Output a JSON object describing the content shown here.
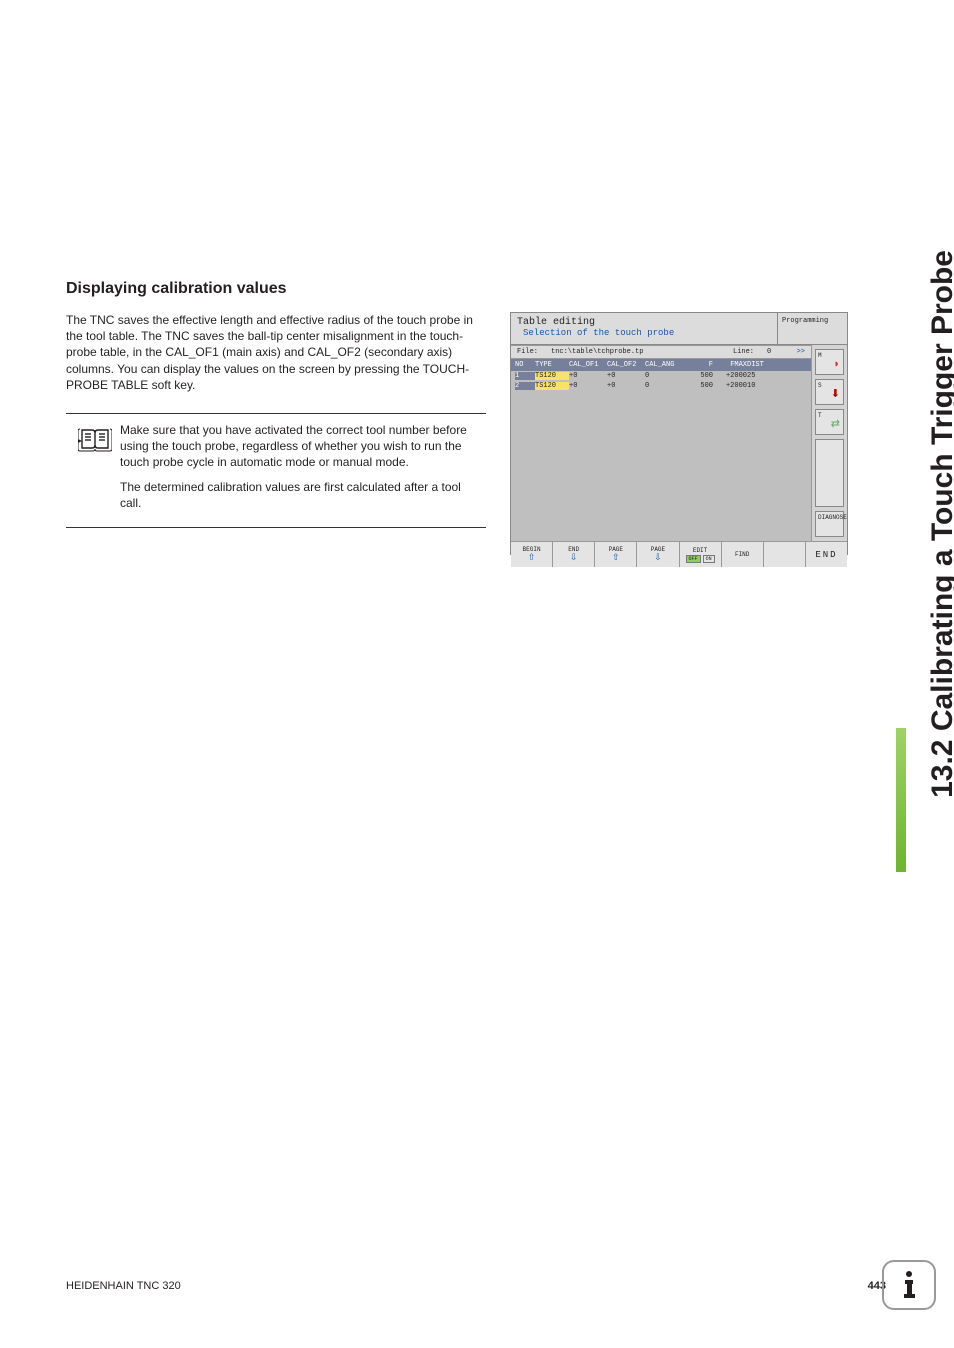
{
  "side_title": "13.2 Calibrating a Touch Trigger Probe",
  "heading": "Displaying calibration values",
  "paragraph": "The TNC saves the effective length and effective radius of the touch probe in the tool table. The TNC saves the ball-tip center misalignment in the touch-probe table, in the CAL_OF1 (main axis) and CAL_OF2 (secondary axis) columns. You can display the values on the screen by pressing the TOUCH-PROBE TABLE soft key.",
  "note": {
    "p1": "Make sure that you have activated the correct tool number before using the touch probe, regardless of whether you wish to run the touch probe cycle in automatic mode or manual mode.",
    "p2": "The determined calibration values are first calculated after a tool call."
  },
  "screenshot": {
    "title": "Table editing",
    "mode": "Programming",
    "subtitle": "Selection of the touch probe",
    "file_label": "File:",
    "file_path": "tnc:\\table\\tchprobe.tp",
    "line_label": "Line:",
    "line_val": "0",
    "arrows": ">>",
    "columns": [
      "NO",
      "TYPE",
      "CAL_OF1",
      "CAL_OF2",
      "CAL_ANG",
      "F",
      "FMAX",
      "DIST"
    ],
    "rows": [
      {
        "no": "1",
        "type": "TS120",
        "o1": "+0",
        "o2": "+0",
        "ang": "0",
        "f": "500",
        "fmax": "+2000",
        "dist": "25"
      },
      {
        "no": "2",
        "type": "TS120",
        "o1": "+0",
        "o2": "+0",
        "ang": "0",
        "f": "500",
        "fmax": "+2000",
        "dist": "10"
      }
    ],
    "side": {
      "m": "M",
      "s": "S",
      "t": "T",
      "diag": "DIAGNOSE"
    },
    "softkeys": {
      "begin": "BEGIN",
      "end": "END",
      "pageu": "PAGE",
      "paged": "PAGE",
      "edit": "EDIT",
      "off": "OFF",
      "on": "ON",
      "find": "FIND",
      "endkey": "END"
    }
  },
  "footer": {
    "left": "HEIDENHAIN TNC 320",
    "page": "443"
  }
}
